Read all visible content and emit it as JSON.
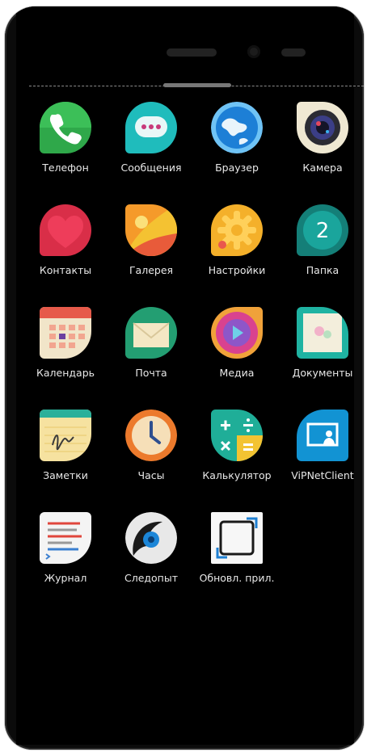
{
  "apps": [
    {
      "label": "Телефон",
      "icon": "phone-icon",
      "color": "#39b54a"
    },
    {
      "label": "Сообщения",
      "icon": "messages-icon",
      "color": "#21c4c4"
    },
    {
      "label": "Браузер",
      "icon": "browser-globe-icon",
      "color": "#1e88e5"
    },
    {
      "label": "Камера",
      "icon": "camera-icon",
      "color": "#f2ecd8"
    },
    {
      "label": "Контакты",
      "icon": "contacts-heart-icon",
      "color": "#e53950"
    },
    {
      "label": "Галерея",
      "icon": "gallery-icon",
      "color": "#f28a24"
    },
    {
      "label": "Настройки",
      "icon": "settings-gear-icon",
      "color": "#f6b12c"
    },
    {
      "label": "Папка",
      "icon": "folder-icon",
      "color": "#1fa59c",
      "badge": "2"
    },
    {
      "label": "Календарь",
      "icon": "calendar-icon",
      "color": "#f0e4c8"
    },
    {
      "label": "Почта",
      "icon": "mail-icon",
      "color": "#2aa67c"
    },
    {
      "label": "Медиа",
      "icon": "media-play-icon",
      "color": "#e24fa0"
    },
    {
      "label": "Документы",
      "icon": "documents-icon",
      "color": "#22b7a6"
    },
    {
      "label": "Заметки",
      "icon": "notes-icon",
      "color": "#f6e3a0"
    },
    {
      "label": "Часы",
      "icon": "clock-icon",
      "color": "#ef7d2f"
    },
    {
      "label": "Калькулятор",
      "icon": "calculator-icon",
      "color": "#21b19a"
    },
    {
      "label": "ViPNetClient",
      "icon": "vipnet-client-icon",
      "color": "#1596d6"
    },
    {
      "label": "Журнал",
      "icon": "journal-icon",
      "color": "#f4f4f4"
    },
    {
      "label": "Следопыт",
      "icon": "tracker-icon",
      "color": "#e9e9e9"
    },
    {
      "label": "Обновл. прил.",
      "icon": "update-apps-icon",
      "color": "#f7f7f7"
    }
  ]
}
